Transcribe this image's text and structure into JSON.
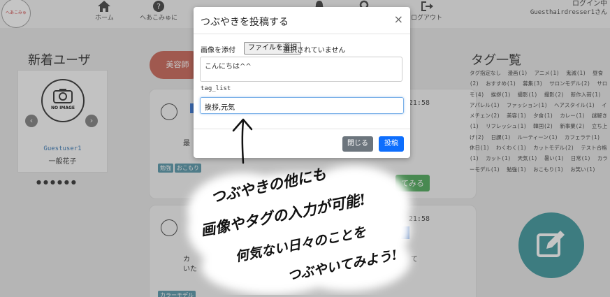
{
  "header": {
    "logo_text": "へあこみゅ",
    "nav": [
      {
        "label": "ホーム",
        "icon": "home-icon"
      },
      {
        "label": "へあこみゅに",
        "icon": "question-icon"
      },
      {
        "label": "",
        "icon": "bell-icon"
      },
      {
        "label": "",
        "icon": "search-icon"
      },
      {
        "label": "ログアウト",
        "icon": "logout-icon"
      }
    ],
    "login_status": "ログイン中",
    "login_user": "Guesthairdresser1さん"
  },
  "left": {
    "title": "新着ユーザ",
    "user_card": {
      "noimage": "NO IMAGE",
      "username": "Guestuser1",
      "display_name": "一般花子"
    },
    "dots": "●●●●●●"
  },
  "center": {
    "category_pill": "美容師",
    "post1": {
      "time": "21:58",
      "text_fragment": "最",
      "tags": [
        "勉強",
        "おこもり"
      ],
      "more_button": "てみる"
    },
    "post2": {
      "time": "21:58",
      "text_line1": "カ",
      "text_line2": "いた",
      "text_end": "て",
      "tags": [
        "カラーモデル"
      ]
    }
  },
  "right": {
    "title": "タグ一覧",
    "tags": [
      "タグ指定なし",
      "漫画(1)",
      "アニメ(1)",
      "鬼滅(1)",
      "昼食(2)",
      "おすすめ(1)",
      "募集(3)",
      "サロンモデル(2)",
      "サロモ(4)",
      "挨拶(1)",
      "撮影(1)",
      "撮影(2)",
      "新作入荷(1)",
      "アパレル(1)",
      "ファッション(1)",
      "ヘアスタイル(1)",
      "イメチェン(2)",
      "美容(1)",
      "夕食(1)",
      "カレー(1)",
      "謎解き(1)",
      "リフレッシュ(1)",
      "韓国(2)",
      "新事業(2)",
      "立ち上げ(2)",
      "日課(1)",
      "ルーティーン(1)",
      "カフェラテ(1)",
      "休日(1)",
      "わくわく(1)",
      "カットモデル(2)",
      "テスト合格(1)",
      "カット(1)",
      "天気(1)",
      "暑い(1)",
      "日常(1)",
      "カラーモデル(1)",
      "勉強(1)",
      "おこもり(1)",
      "お笑い(1)"
    ]
  },
  "modal": {
    "title": "つぶやきを投稿する",
    "close_symbol": "×",
    "image_label": "画像を添付",
    "file_button": "ファイルを選択",
    "file_status": "選択されていません",
    "textarea_value": "こんにちは^^",
    "tag_label": "tag_list",
    "tag_value": "挨拶,元気",
    "close_button": "閉じる",
    "post_button": "投稿"
  },
  "annotation": {
    "line1": "つぶやきの他にも",
    "line2": "画像やタグの入力が可能!",
    "line3": "何気ない日々のことを",
    "line4": "つぶやいてみよう!"
  },
  "colors": {
    "teal": "#2f8f95",
    "primary": "#0d6efd",
    "secondary": "#6c757d",
    "green": "#3fa34d",
    "tag_chip": "#4a8fa3",
    "pill": "#c65a4a"
  }
}
